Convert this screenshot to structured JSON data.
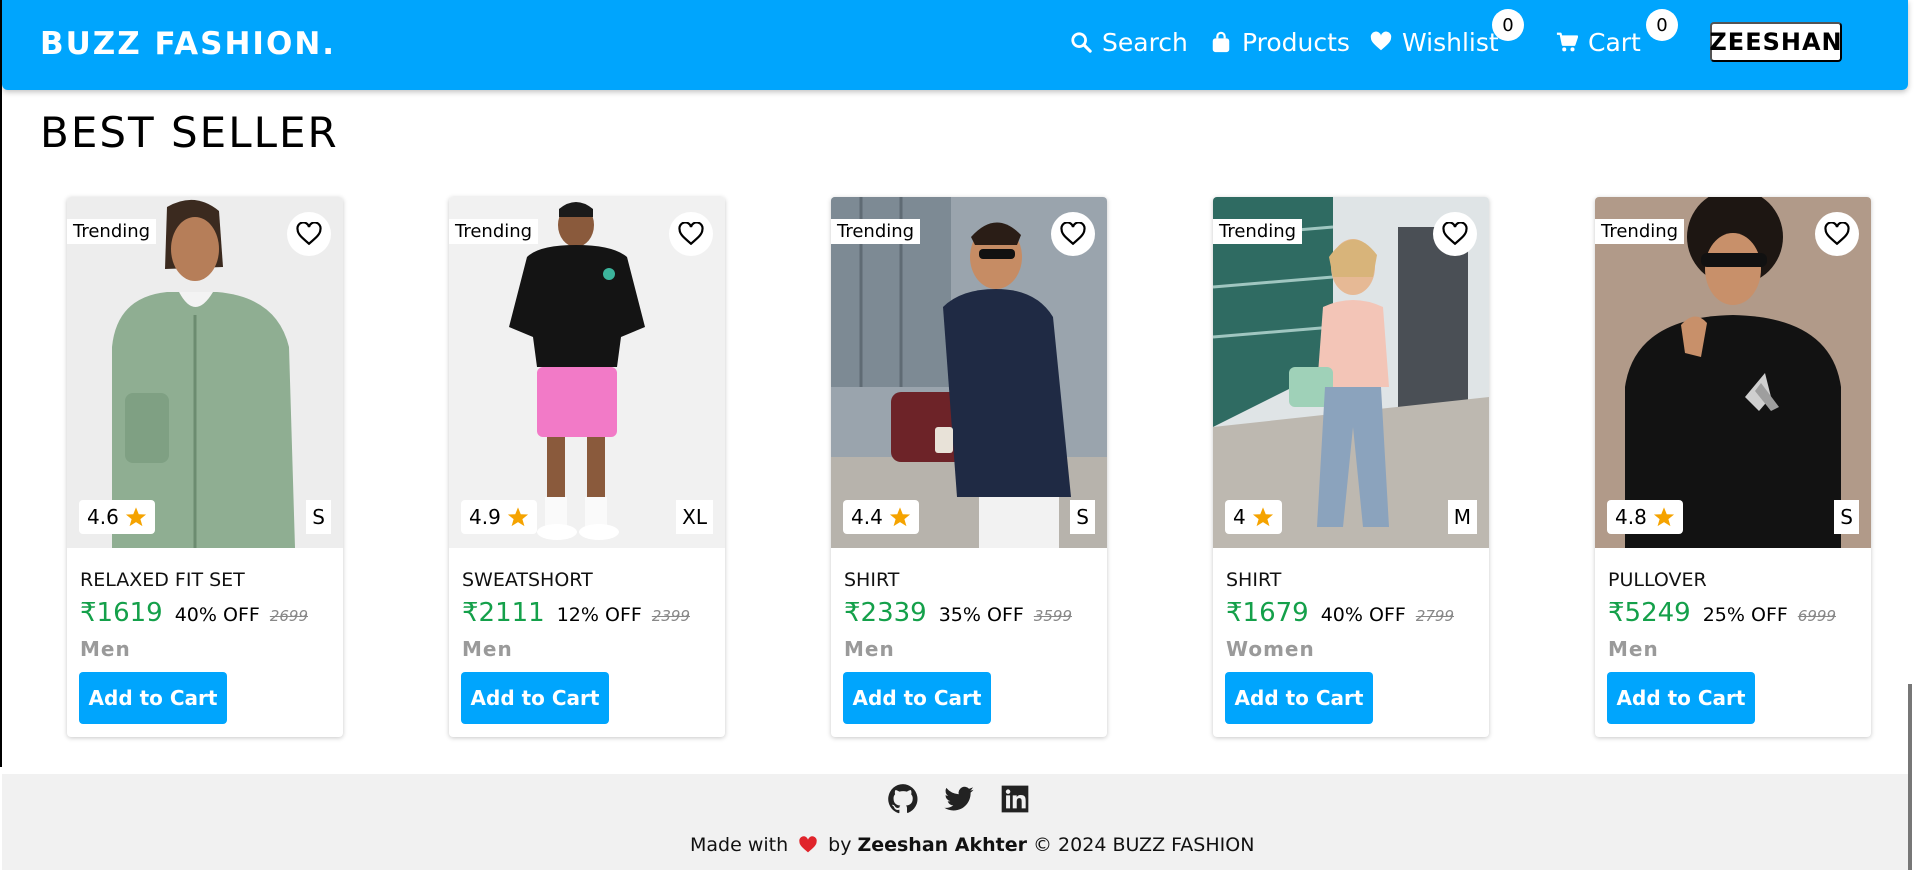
{
  "navbar": {
    "brand": "BUZZ FASHION.",
    "search_label": "Search",
    "products_label": "Products",
    "wishlist_label": "Wishlist",
    "wishlist_count": "0",
    "cart_label": "Cart",
    "cart_count": "0",
    "user_label": "ZEESHAN"
  },
  "section": {
    "title": "BEST SELLER"
  },
  "products": [
    {
      "badge": "Trending",
      "rating": "4.6",
      "size": "S",
      "name": "RELAXED FIT SET",
      "price": "₹1619",
      "discount": "40% OFF",
      "mrp": "2699",
      "category": "Men",
      "cta": "Add to Cart"
    },
    {
      "badge": "Trending",
      "rating": "4.9",
      "size": "XL",
      "name": "SWEATSHORT",
      "price": "₹2111",
      "discount": "12% OFF",
      "mrp": "2399",
      "category": "Men",
      "cta": "Add to Cart"
    },
    {
      "badge": "Trending",
      "rating": "4.4",
      "size": "S",
      "name": "SHIRT",
      "price": "₹2339",
      "discount": "35% OFF",
      "mrp": "3599",
      "category": "Men",
      "cta": "Add to Cart"
    },
    {
      "badge": "Trending",
      "rating": "4",
      "size": "M",
      "name": "SHIRT",
      "price": "₹1679",
      "discount": "40% OFF",
      "mrp": "2799",
      "category": "Women",
      "cta": "Add to Cart"
    },
    {
      "badge": "Trending",
      "rating": "4.8",
      "size": "S",
      "name": "PULLOVER",
      "price": "₹5249",
      "discount": "25% OFF",
      "mrp": "6999",
      "category": "Men",
      "cta": "Add to Cart"
    }
  ],
  "footer": {
    "made_with": "Made with",
    "by": "by",
    "author": "Zeeshan Akhter",
    "copyright": "© 2024 BUZZ FASHION",
    "social_icons": [
      "github-icon",
      "twitter-icon",
      "linkedin-icon"
    ]
  },
  "colors": {
    "primary": "#00a5fd",
    "price_green": "#14a04a",
    "star": "#f5a300",
    "footer_bg": "#f1f1f1"
  }
}
